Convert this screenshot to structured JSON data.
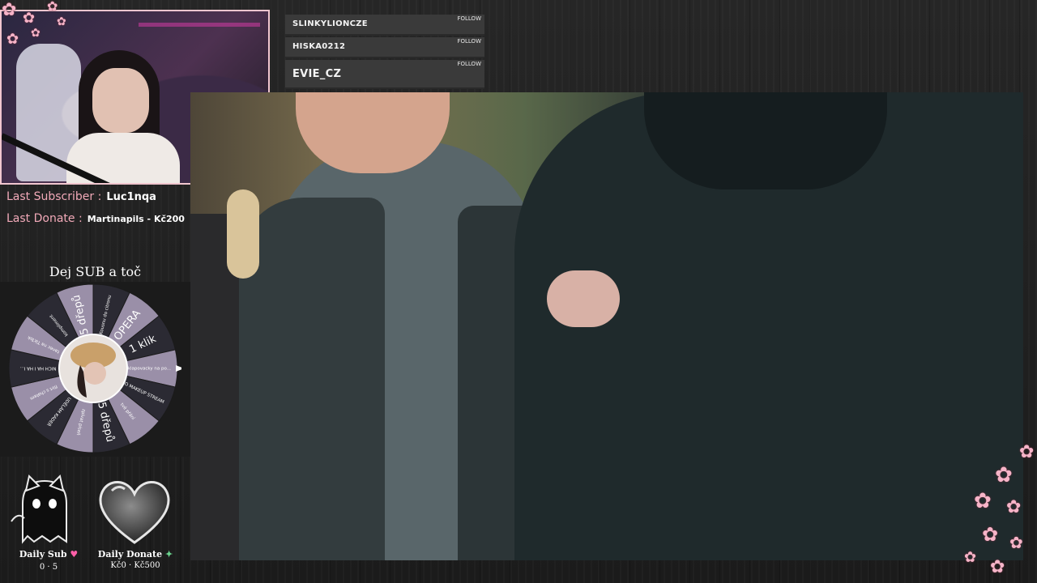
{
  "followers": [
    {
      "name": "SLINKYLIONCZE",
      "action": "FOLLOW"
    },
    {
      "name": "HISKA0212",
      "action": "FOLLOW"
    },
    {
      "name": "EVIE_CZ",
      "action": "FOLLOW"
    }
  ],
  "last_subscriber": {
    "label": "Last Subscriber :",
    "value": "Luc1nqa"
  },
  "last_donate": {
    "label": "Last Donate :",
    "value": "Martinapils - Kč200"
  },
  "wheel": {
    "title": "Dej SUB a toč",
    "segments": [
      "Kousnu do citronu",
      "OPERA",
      "1 klik",
      "sklapovacky na po...",
      "NO MAKEUP STREAM",
      "tvé přání",
      "5 dřepů",
      "zpívat píseň",
      "UDĚLÁM KADEŘ",
      "flirt s chatem",
      "NICH HA I HA I...",
      "tanec na TikTok",
      "kompliment",
      "5 dřepů"
    ]
  },
  "daily_sub": {
    "label": "Daily Sub",
    "icon": "pink-heart-icon",
    "value": "0 · 5"
  },
  "daily_donate": {
    "label": "Daily Donate",
    "icon": "money-icon",
    "value": "Kč0 · Kč500"
  },
  "colors": {
    "accent": "#f1a9b8",
    "wheel_light": "#9a8fa8",
    "wheel_dark": "#2b2a33"
  }
}
